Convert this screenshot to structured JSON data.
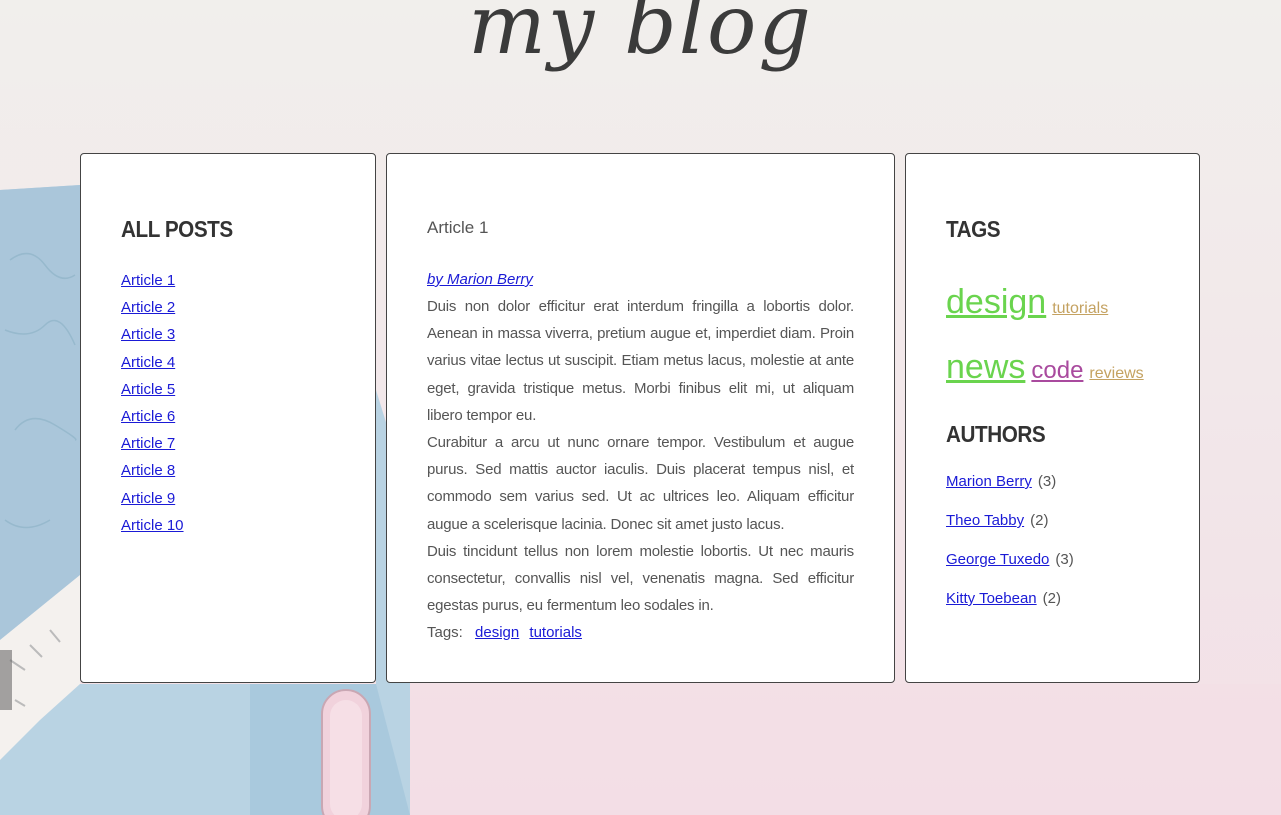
{
  "site": {
    "title": "my blog"
  },
  "sidebar_left": {
    "heading": "ALL POSTS",
    "posts": [
      "Article 1",
      "Article 2",
      "Article 3",
      "Article 4",
      "Article 5",
      "Article 6",
      "Article 7",
      "Article 8",
      "Article 9",
      "Article 10"
    ]
  },
  "article": {
    "title": "Article 1",
    "byline": "by Marion Berry",
    "paragraphs": [
      "Duis non dolor efficitur erat interdum fringilla a lobortis dolor. Aenean in massa viverra, pretium augue et, imperdiet diam. Proin varius vitae lectus ut suscipit. Etiam metus lacus, molestie at ante eget, gravida tristique metus. Morbi finibus elit mi, ut aliquam libero tempor eu.",
      "Curabitur a arcu ut nunc ornare tempor. Vestibulum et augue purus. Sed mattis auctor iaculis. Duis placerat tempus nisl, et commodo sem varius sed. Ut ac ultrices leo. Aliquam efficitur augue a scelerisque lacinia. Donec sit amet justo lacus.",
      "Duis tincidunt tellus non lorem molestie lobortis. Ut nec mauris consectetur, convallis nisl vel, venenatis magna. Sed efficitur egestas purus, eu fermentum leo sodales in."
    ],
    "tags_label": "Tags:",
    "tags": [
      "design",
      "tutorials"
    ]
  },
  "sidebar_right": {
    "tags_heading": "TAGS",
    "tag_cloud": [
      {
        "label": "design",
        "color": "#6ad44e"
      },
      {
        "label": "tutorials",
        "color": "#c4a261"
      },
      {
        "label": "news",
        "color": "#6ad44e"
      },
      {
        "label": "code",
        "color": "#a94a9e"
      },
      {
        "label": "reviews",
        "color": "#c4a261"
      }
    ],
    "authors_heading": "AUTHORS",
    "authors": [
      {
        "name": "Marion Berry",
        "count": "(3)"
      },
      {
        "name": "Theo Tabby",
        "count": "(2)"
      },
      {
        "name": "George Tuxedo",
        "count": "(3)"
      },
      {
        "name": "Kitty Toebean",
        "count": "(2)"
      }
    ]
  },
  "colors": {
    "link": "#1a1ad6",
    "heading": "#333333",
    "panel_border": "#444444"
  }
}
